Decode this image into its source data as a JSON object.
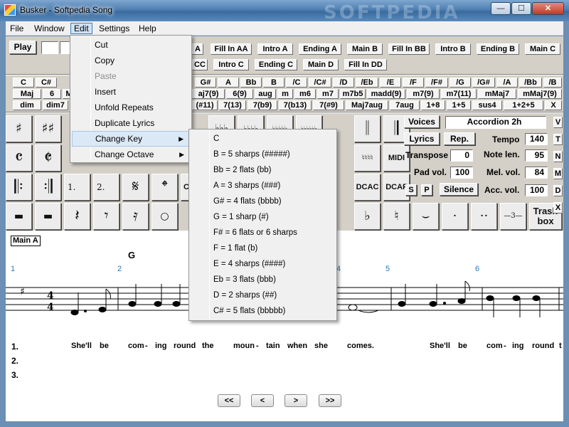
{
  "window": {
    "title": "Busker - Softpedia Song",
    "watermark": "SOFTPEDIA"
  },
  "window_buttons": {
    "minimize": "—",
    "maximize": "☐",
    "close": "✕"
  },
  "menubar": [
    "File",
    "Window",
    "Edit",
    "Settings",
    "Help"
  ],
  "play_button": "Play",
  "sections": [
    "Fill In AA",
    "Intro A",
    "Ending A",
    "Main B",
    "Fill In BB",
    "Intro B",
    "Ending B",
    "Main C",
    "CC",
    "Intro C",
    "Ending C",
    "Main D",
    "Fill In DD"
  ],
  "chord_roots": [
    "C",
    "C#",
    "G#",
    "A",
    "Bb",
    "B",
    "/C",
    "/C#",
    "/D",
    "/Eb",
    "/E",
    "/F",
    "/F#",
    "/G",
    "/G#",
    "/A",
    "/Bb",
    "/B"
  ],
  "chord_types_1": [
    "Maj",
    "6",
    "M",
    "aj7(9)",
    "6(9)",
    "aug",
    "m",
    "m6",
    "m7",
    "m7b5",
    "madd(9)",
    "m7(9)",
    "m7(11)",
    "mMaj7",
    "mMaj7(9)"
  ],
  "chord_types_2": [
    "dim",
    "dim7",
    "(#11)",
    "7(13)",
    "7(b9)",
    "7(b13)",
    "7(#9)",
    "Maj7aug",
    "7aug",
    "1+8",
    "1+5",
    "sus4",
    "1+2+5",
    "X"
  ],
  "symbols": {
    "row1": [
      "♯",
      "♯♯",
      "♭♭♭",
      "♭♭♭♭",
      "♭♭♭♭♭",
      "♭♭♭♭♭♭",
      "𝄁",
      "𝄂"
    ],
    "row2": [
      "𝄴",
      "𝄵",
      "♮♮♮♮",
      "MIDI"
    ],
    "row3": [
      "𝄆",
      "𝄇",
      "1.",
      "2.",
      "𝄋",
      "𝄌",
      "Co",
      "DCAC",
      "DCAF"
    ],
    "row4": [
      "▬",
      "▬",
      "𝄽",
      "𝄾",
      "𝄿",
      "○",
      "♭",
      "♮",
      "⌣",
      "·",
      "··",
      "—3—"
    ],
    "trash": "Trash box"
  },
  "controls": {
    "voices_button": "Voices",
    "voice_name": "Accordion 2h",
    "lyrics_button": "Lyrics",
    "rep_button": "Rep.",
    "tempo_label": "Tempo",
    "tempo": "140",
    "transpose_label": "Transpose",
    "transpose": "0",
    "note_len_label": "Note len.",
    "note_len": "95",
    "pad_vol_label": "Pad vol.",
    "pad_vol": "100",
    "mel_vol_label": "Mel. vol.",
    "mel_vol": "84",
    "s_button": "S",
    "p_button": "P",
    "silence_button": "Silence",
    "acc_vol_label": "Acc. vol.",
    "acc_vol": "100",
    "right_edge": [
      "V",
      "T",
      "N",
      "M",
      "D",
      "X"
    ]
  },
  "score": {
    "part": "Main A",
    "chord": "G",
    "bar_numbers": [
      "1",
      "2",
      "4",
      "5",
      "6"
    ],
    "time_signature": [
      "4",
      "4"
    ],
    "verses": [
      "1.",
      "2.",
      "3."
    ],
    "lyrics": [
      "She'll",
      "be",
      "com",
      "-",
      "ing",
      "round",
      "the",
      "moun",
      "-",
      "tain",
      "when",
      "she",
      "comes.",
      "She'll",
      "be",
      "com",
      "-",
      "ing",
      "round",
      "t"
    ]
  },
  "nav_buttons": [
    "<<",
    "<",
    ">",
    ">>"
  ],
  "edit_menu": [
    {
      "label": "Cut",
      "enabled": true
    },
    {
      "label": "Copy",
      "enabled": true
    },
    {
      "label": "Paste",
      "enabled": false
    },
    {
      "label": "Insert",
      "enabled": true
    },
    {
      "label": "Unfold Repeats",
      "enabled": true
    },
    {
      "label": "Duplicate Lyrics",
      "enabled": true
    },
    {
      "label": "Change Key",
      "enabled": true,
      "submenu": true
    },
    {
      "label": "Change Octave",
      "enabled": true,
      "submenu": true
    }
  ],
  "change_key_menu": [
    "C",
    "B = 5 sharps (#####)",
    "Bb = 2 flats (bb)",
    "A = 3 sharps (###)",
    "G# = 4 flats (bbbb)",
    "G = 1 sharp (#)",
    "F# = 6 flats or 6 sharps",
    "F = 1 flat (b)",
    "E = 4 sharps (####)",
    "Eb = 3 flats (bbb)",
    "D = 2 sharps (##)",
    "C# = 5 flats (bbbbb)"
  ]
}
